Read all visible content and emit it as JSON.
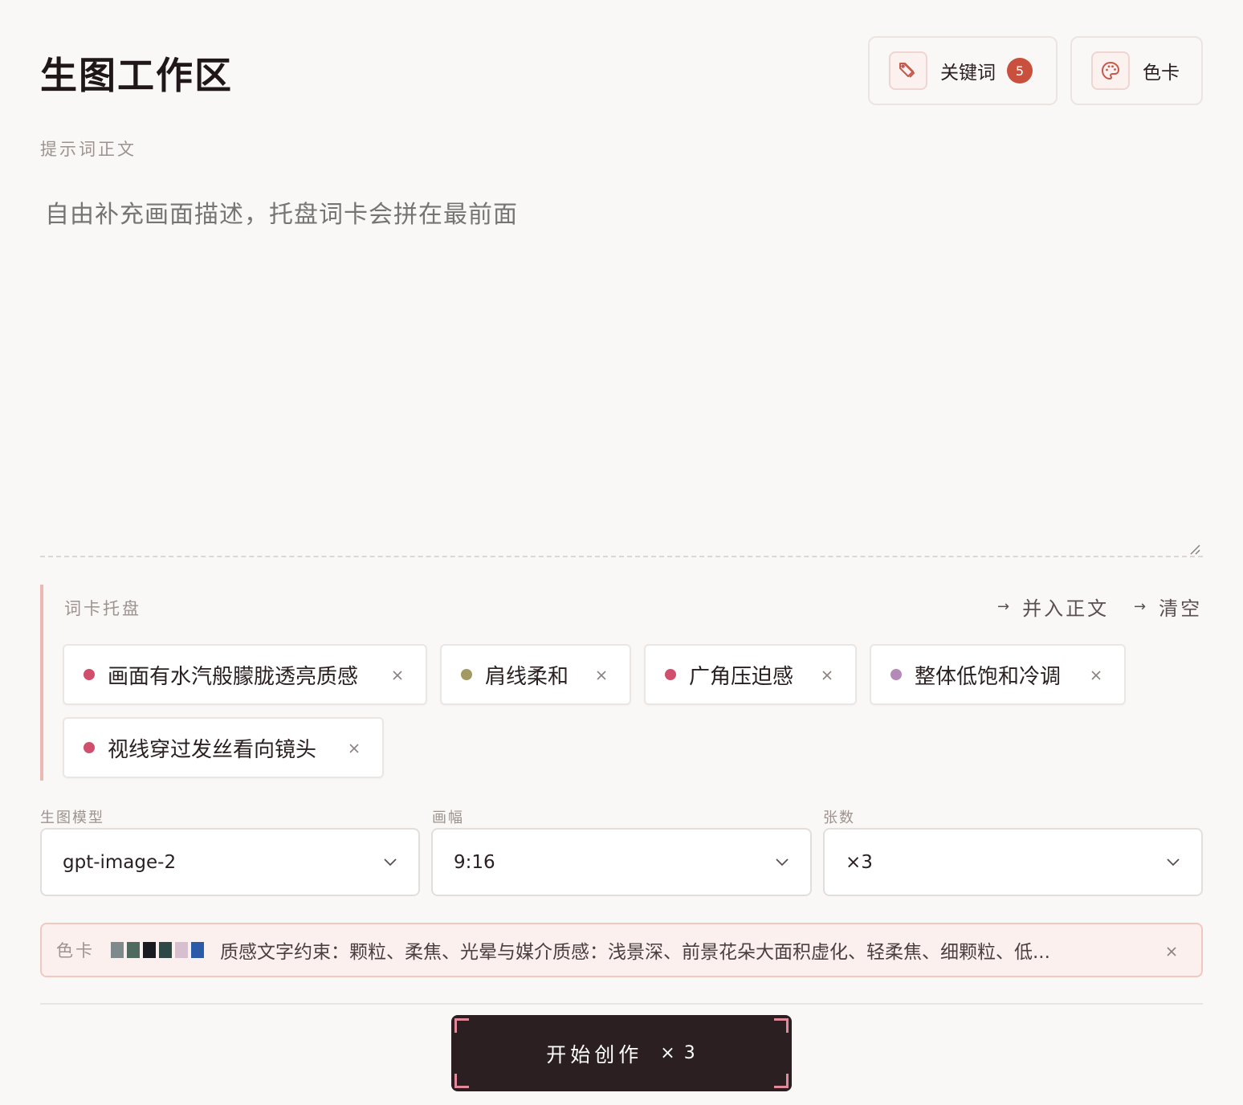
{
  "header": {
    "title": "生图工作区",
    "keywords_label": "关键词",
    "keywords_count": "5",
    "color_card_label": "色卡"
  },
  "prompt": {
    "label": "提示词正文",
    "placeholder": "自由补充画面描述，托盘词卡会拼在最前面"
  },
  "tray": {
    "title": "词卡托盘",
    "merge_label": "并入正文",
    "clear_label": "清空",
    "arrow": "→",
    "chips": [
      {
        "text": "画面有水汽般朦胧透亮质感",
        "color": "#cf4f6c"
      },
      {
        "text": "肩线柔和",
        "color": "#a39a63"
      },
      {
        "text": "广角压迫感",
        "color": "#cf4f6c"
      },
      {
        "text": "整体低饱和冷调",
        "color": "#b48ab8"
      },
      {
        "text": "视线穿过发丝看向镜头",
        "color": "#cf4f6c"
      }
    ]
  },
  "settings": {
    "model_label": "生图模型",
    "model_value": "gpt-image-2",
    "ratio_label": "画幅",
    "ratio_value": "9:16",
    "count_label": "张数",
    "count_value": "×3"
  },
  "color_card": {
    "label": "色卡",
    "swatches": [
      "#7e8a8c",
      "#4f6a5f",
      "#1a1b22",
      "#2e4846",
      "#d8bfd0",
      "#2a5aa8"
    ],
    "text": "质感文字约束：颗粒、柔焦、光晕与媒介质感：浅景深、前景花朵大面积虚化、轻柔焦、细颗粒、低..."
  },
  "start": {
    "label": "开始创作",
    "multiplier": "× 3"
  }
}
